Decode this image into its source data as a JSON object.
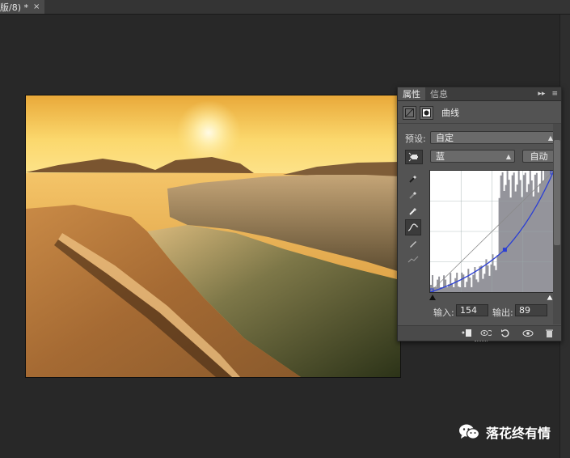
{
  "document_tab": {
    "title": "版/8) *",
    "close_glyph": "×"
  },
  "panel": {
    "tabs": [
      "属性",
      "信息"
    ],
    "title": "曲线",
    "preset_label": "预设:",
    "preset_value": "自定",
    "channel_value": "蓝",
    "auto_button": "自动",
    "input_label": "输入:",
    "input_value": "154",
    "output_label": "输出:",
    "output_value": "89",
    "curve_point": {
      "input": 154,
      "output": 89
    }
  },
  "watermark": {
    "text": "落花终有情",
    "icon": "wechat-icon"
  },
  "colors": {
    "curve": "#2b3fd4",
    "histogram": "#8e8e96",
    "panel": "#535353",
    "workspace": "#282828"
  }
}
